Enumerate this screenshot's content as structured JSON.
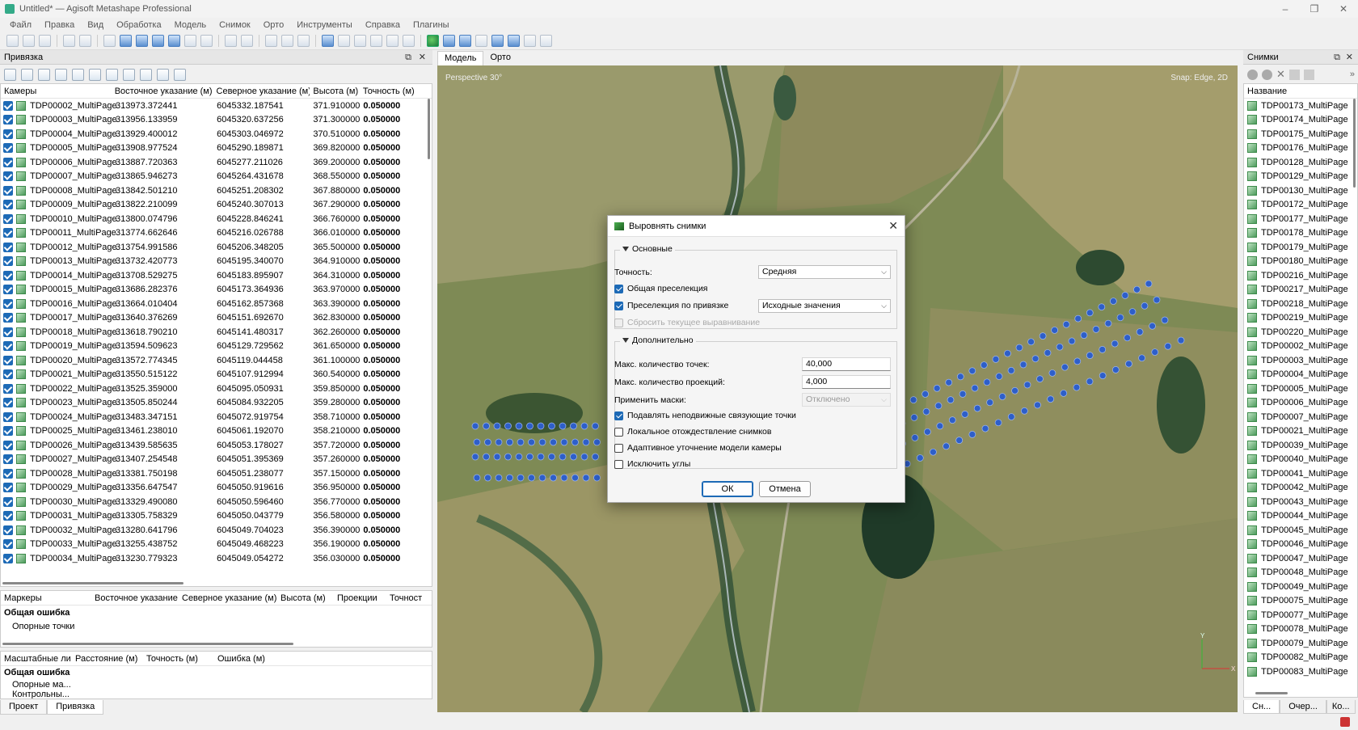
{
  "window": {
    "title": "Untitled* — Agisoft Metashape Professional"
  },
  "menu": [
    "Файл",
    "Правка",
    "Вид",
    "Обработка",
    "Модель",
    "Снимок",
    "Орто",
    "Инструменты",
    "Справка",
    "Плагины"
  ],
  "left_panel": {
    "title": "Привязка",
    "cameras": {
      "headers": [
        "Камеры",
        "Восточное указание (м)",
        "Северное указание (м)",
        "Высота (м)",
        "Точность (м)"
      ],
      "rows": [
        [
          "TDP00002_MultiPage",
          "313973.372441",
          "6045332.187541",
          "371.910000",
          "0.050000"
        ],
        [
          "TDP00003_MultiPage",
          "313956.133959",
          "6045320.637256",
          "371.300000",
          "0.050000"
        ],
        [
          "TDP00004_MultiPage",
          "313929.400012",
          "6045303.046972",
          "370.510000",
          "0.050000"
        ],
        [
          "TDP00005_MultiPage",
          "313908.977524",
          "6045290.189871",
          "369.820000",
          "0.050000"
        ],
        [
          "TDP00006_MultiPage",
          "313887.720363",
          "6045277.211026",
          "369.200000",
          "0.050000"
        ],
        [
          "TDP00007_MultiPage",
          "313865.946273",
          "6045264.431678",
          "368.550000",
          "0.050000"
        ],
        [
          "TDP00008_MultiPage",
          "313842.501210",
          "6045251.208302",
          "367.880000",
          "0.050000"
        ],
        [
          "TDP00009_MultiPage",
          "313822.210099",
          "6045240.307013",
          "367.290000",
          "0.050000"
        ],
        [
          "TDP00010_MultiPage",
          "313800.074796",
          "6045228.846241",
          "366.760000",
          "0.050000"
        ],
        [
          "TDP00011_MultiPage",
          "313774.662646",
          "6045216.026788",
          "366.010000",
          "0.050000"
        ],
        [
          "TDP00012_MultiPage",
          "313754.991586",
          "6045206.348205",
          "365.500000",
          "0.050000"
        ],
        [
          "TDP00013_MultiPage",
          "313732.420773",
          "6045195.340070",
          "364.910000",
          "0.050000"
        ],
        [
          "TDP00014_MultiPage",
          "313708.529275",
          "6045183.895907",
          "364.310000",
          "0.050000"
        ],
        [
          "TDP00015_MultiPage",
          "313686.282376",
          "6045173.364936",
          "363.970000",
          "0.050000"
        ],
        [
          "TDP00016_MultiPage",
          "313664.010404",
          "6045162.857368",
          "363.390000",
          "0.050000"
        ],
        [
          "TDP00017_MultiPage",
          "313640.376269",
          "6045151.692670",
          "362.830000",
          "0.050000"
        ],
        [
          "TDP00018_MultiPage",
          "313618.790210",
          "6045141.480317",
          "362.260000",
          "0.050000"
        ],
        [
          "TDP00019_MultiPage",
          "313594.509623",
          "6045129.729562",
          "361.650000",
          "0.050000"
        ],
        [
          "TDP00020_MultiPage",
          "313572.774345",
          "6045119.044458",
          "361.100000",
          "0.050000"
        ],
        [
          "TDP00021_MultiPage",
          "313550.515122",
          "6045107.912994",
          "360.540000",
          "0.050000"
        ],
        [
          "TDP00022_MultiPage",
          "313525.359000",
          "6045095.050931",
          "359.850000",
          "0.050000"
        ],
        [
          "TDP00023_MultiPage",
          "313505.850244",
          "6045084.932205",
          "359.280000",
          "0.050000"
        ],
        [
          "TDP00024_MultiPage",
          "313483.347151",
          "6045072.919754",
          "358.710000",
          "0.050000"
        ],
        [
          "TDP00025_MultiPage",
          "313461.238010",
          "6045061.192070",
          "358.210000",
          "0.050000"
        ],
        [
          "TDP00026_MultiPage",
          "313439.585635",
          "6045053.178027",
          "357.720000",
          "0.050000"
        ],
        [
          "TDP00027_MultiPage",
          "313407.254548",
          "6045051.395369",
          "357.260000",
          "0.050000"
        ],
        [
          "TDP00028_MultiPage",
          "313381.750198",
          "6045051.238077",
          "357.150000",
          "0.050000"
        ],
        [
          "TDP00029_MultiPage",
          "313356.647547",
          "6045050.919616",
          "356.950000",
          "0.050000"
        ],
        [
          "TDP00030_MultiPage",
          "313329.490080",
          "6045050.596460",
          "356.770000",
          "0.050000"
        ],
        [
          "TDP00031_MultiPage",
          "313305.758329",
          "6045050.043779",
          "356.580000",
          "0.050000"
        ],
        [
          "TDP00032_MultiPage",
          "313280.641796",
          "6045049.704023",
          "356.390000",
          "0.050000"
        ],
        [
          "TDP00033_MultiPage",
          "313255.438752",
          "6045049.468223",
          "356.190000",
          "0.050000"
        ],
        [
          "TDP00034_MultiPage",
          "313230.779323",
          "6045049.054272",
          "356.030000",
          "0.050000"
        ]
      ]
    },
    "markers": {
      "headers": [
        "Маркеры",
        "Восточное указание",
        "Северное указание (м)",
        "Высота (м)",
        "Проекции",
        "Точност"
      ],
      "rows": [
        "Общая ошибка",
        "Опорные точки"
      ]
    },
    "scalebars": {
      "headers": [
        "Масштабные ли",
        "Расстояние (м)",
        "Точность (м)",
        "Ошибка (м)"
      ],
      "rows": [
        "Общая ошибка",
        "Опорные ма...",
        "Контрольны..."
      ]
    },
    "tabs": [
      "Проект",
      "Привязка"
    ]
  },
  "view": {
    "tabs": [
      "Модель",
      "Орто"
    ],
    "perspective": "Perspective 30°",
    "snap": "Snap: Edge, 2D"
  },
  "dialog": {
    "title": "Выровнять снимки",
    "section_basic": "Основные",
    "accuracy_label": "Точность:",
    "accuracy_value": "Средняя",
    "generic_preselection": "Общая преселекция",
    "reference_preselection": "Преселекция по привязке",
    "reference_preselection_mode": "Исходные значения",
    "reset_alignment": "Сбросить текущее выравнивание",
    "section_advanced": "Дополнительно",
    "key_point_limit_label": "Макс. количество точек:",
    "key_point_limit": "40,000",
    "tie_point_limit_label": "Макс. количество проекций:",
    "tie_point_limit": "4,000",
    "masks_label": "Применить маски:",
    "masks_value": "Отключено",
    "filter_stationary": "Подавлять неподвижные связующие точки",
    "guided_matching": "Локальное отождествление снимков",
    "adaptive_fitting": "Адаптивное уточнение модели камеры",
    "exclude_corners": "Исключить углы",
    "ok": "ОК",
    "cancel": "Отмена"
  },
  "right_panel": {
    "title": "Снимки",
    "header": "Название",
    "items": [
      "TDP00173_MultiPage",
      "TDP00174_MultiPage",
      "TDP00175_MultiPage",
      "TDP00176_MultiPage",
      "TDP00128_MultiPage",
      "TDP00129_MultiPage",
      "TDP00130_MultiPage",
      "TDP00172_MultiPage",
      "TDP00177_MultiPage",
      "TDP00178_MultiPage",
      "TDP00179_MultiPage",
      "TDP00180_MultiPage",
      "TDP00216_MultiPage",
      "TDP00217_MultiPage",
      "TDP00218_MultiPage",
      "TDP00219_MultiPage",
      "TDP00220_MultiPage",
      "TDP00002_MultiPage",
      "TDP00003_MultiPage",
      "TDP00004_MultiPage",
      "TDP00005_MultiPage",
      "TDP00006_MultiPage",
      "TDP00007_MultiPage",
      "TDP00021_MultiPage",
      "TDP00039_MultiPage",
      "TDP00040_MultiPage",
      "TDP00041_MultiPage",
      "TDP00042_MultiPage",
      "TDP00043_MultiPage",
      "TDP00044_MultiPage",
      "TDP00045_MultiPage",
      "TDP00046_MultiPage",
      "TDP00047_MultiPage",
      "TDP00048_MultiPage",
      "TDP00049_MultiPage",
      "TDP00075_MultiPage",
      "TDP00077_MultiPage",
      "TDP00078_MultiPage",
      "TDP00079_MultiPage",
      "TDP00082_MultiPage",
      "TDP00083_MultiPage"
    ],
    "tabs": [
      "Сн...",
      "Очер...",
      "Ко..."
    ]
  }
}
